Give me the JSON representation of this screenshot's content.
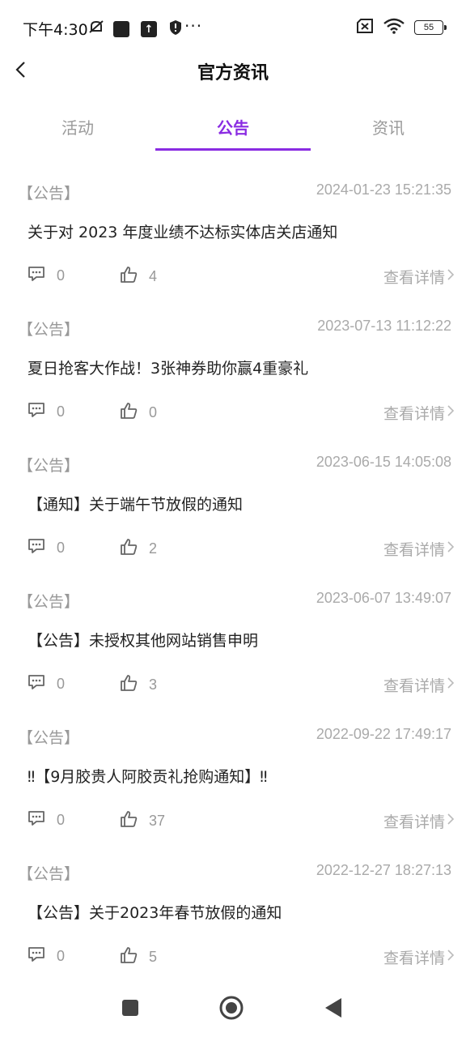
{
  "status_bar": {
    "time": "下午4:30",
    "battery": "55"
  },
  "header": {
    "title": "官方资讯"
  },
  "tabs": [
    {
      "label": "活动",
      "active": false
    },
    {
      "label": "公告",
      "active": true
    },
    {
      "label": "资讯",
      "active": false
    }
  ],
  "detail_label": "查看详情",
  "items": [
    {
      "tag": "【公告】",
      "time": "2024-01-23 15:21:35",
      "title": "关于对 2023 年度业绩不达标实体店关店通知",
      "comments": "0",
      "likes": "4"
    },
    {
      "tag": "【公告】",
      "time": "2023-07-13 11:12:22",
      "title": "夏日抢客大作战！3张神券助你赢4重豪礼",
      "comments": "0",
      "likes": "0"
    },
    {
      "tag": "【公告】",
      "time": "2023-06-15 14:05:08",
      "title": "【通知】关于端午节放假的通知",
      "comments": "0",
      "likes": "2"
    },
    {
      "tag": "【公告】",
      "time": "2023-06-07 13:49:07",
      "title": "【公告】未授权其他网站销售申明",
      "comments": "0",
      "likes": "3"
    },
    {
      "tag": "【公告】",
      "time": "2022-09-22 17:49:17",
      "title": "‼【9月胶贵人阿胶贡礼抢购通知】‼",
      "comments": "0",
      "likes": "37"
    },
    {
      "tag": "【公告】",
      "time": "2022-12-27 18:27:13",
      "title": "【公告】关于2023年春节放假的通知",
      "comments": "0",
      "likes": "5"
    }
  ],
  "colors": {
    "accent": "#8a2be2"
  }
}
